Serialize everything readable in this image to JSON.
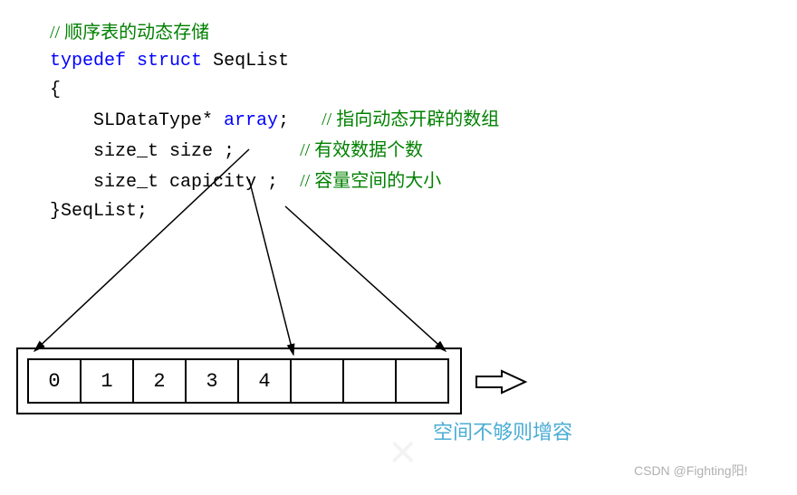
{
  "code": {
    "comment_top": "// 顺序表的动态存储",
    "kw_typedef": "typedef",
    "kw_struct": "struct",
    "name": "SeqList",
    "brace_open": "{",
    "type_ptr": "SLDataType* ",
    "var_array": "array",
    "semi": ";",
    "comment_array": "// 指向动态开辟的数组",
    "size_decl": "size_t size ;",
    "comment_size": "// 有效数据个数",
    "cap_decl": "size_t capicity ;",
    "comment_cap": "// 容量空间的大小",
    "brace_close": "}SeqList;"
  },
  "cells": [
    "0",
    "1",
    "2",
    "3",
    "4",
    "",
    "",
    ""
  ],
  "caption": "空间不够则增容",
  "csdn": "CSDN @Fighting阳!"
}
